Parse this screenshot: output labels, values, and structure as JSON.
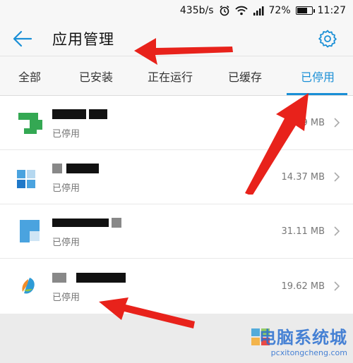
{
  "status_bar": {
    "speed": "435b/s",
    "battery": "72%",
    "battery_level": 0.72,
    "time": "11:27"
  },
  "header": {
    "title": "应用管理"
  },
  "tabs": [
    {
      "label": "全部",
      "active": false
    },
    {
      "label": "已安装",
      "active": false
    },
    {
      "label": "正在运行",
      "active": false
    },
    {
      "label": "已缓存",
      "active": false
    },
    {
      "label": "已停用",
      "active": true
    }
  ],
  "apps": [
    {
      "status": "已停用",
      "size": "9 MB"
    },
    {
      "status": "已停用",
      "size": "14.37 MB"
    },
    {
      "status": "已停用",
      "size": "31.11 MB"
    },
    {
      "status": "已停用",
      "size": "19.62 MB"
    }
  ],
  "watermark": {
    "text": "电脑系统城",
    "url": "pcxitongcheng.com"
  },
  "colors": {
    "accent": "#1a8fd6",
    "annotation_arrow": "#e8221b"
  }
}
